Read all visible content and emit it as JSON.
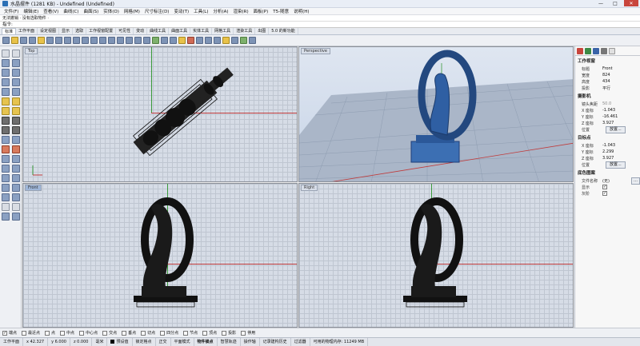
{
  "window": {
    "title": "水晶摆件 (1281 KB) - Undefined (Undefined)",
    "min": "—",
    "max": "□",
    "close": "✕"
  },
  "menu": [
    "文件(F)",
    "编辑(E)",
    "查看(V)",
    "曲线(C)",
    "曲面(S)",
    "实体(O)",
    "网格(M)",
    "尺寸标注(D)",
    "变动(T)",
    "工具(L)",
    "分析(A)",
    "渲染(R)",
    "面板(P)",
    "T5-随意",
    "说明(H)"
  ],
  "command": {
    "history": "无法撤销 · 没有选取物件 ·",
    "prompt": "指令:"
  },
  "tabs": [
    "标准",
    "工作平面",
    "设定视图",
    "显示",
    "选取",
    "工作视窗配置",
    "可见性",
    "变动",
    "曲线工具",
    "曲面工具",
    "实体工具",
    "网格工具",
    "渲染工具",
    "出图",
    "5.0 的新功能"
  ],
  "viewports": {
    "top": "Top",
    "perspective": "Perspective",
    "front": "Front",
    "right": "Right"
  },
  "panel": {
    "section_viewport": "工作视窗",
    "title_label": "标题",
    "title_value": "Front",
    "width_label": "宽度",
    "width_value": "824",
    "height_label": "高度",
    "height_value": "434",
    "projection_label": "投影",
    "projection_value": "平行",
    "section_camera": "摄影机",
    "lens_label": "镜头焦距",
    "lens_value": "50.0",
    "cx_label": "X 座标",
    "cx_value": "-1.043",
    "cy_label": "Y 座标",
    "cy_value": "-16.461",
    "cz_label": "Z 座标",
    "cz_value": "3.927",
    "pos_label": "位置",
    "place_btn": "放置...",
    "section_target": "目标点",
    "tx_label": "X 座标",
    "tx_value": "-1.043",
    "ty_label": "Y 座标",
    "ty_value": "2.299",
    "tz_label": "Z 座标",
    "tz_value": "3.927",
    "tpos_label": "位置",
    "tplace_btn": "放置...",
    "section_wallpaper": "底色图案",
    "file_label": "文件名称",
    "file_value": "(无)",
    "show_label": "显示",
    "gray_label": "灰阶",
    "check": "✓"
  },
  "osnap": [
    "端点",
    "最近点",
    "点",
    "中点",
    "中心点",
    "交点",
    "垂点",
    "切点",
    "四分点",
    "节点",
    "顶点",
    "投影",
    "停用"
  ],
  "status": {
    "workplane": "工作平面",
    "x": "x 42.327",
    "y": "y 6.000",
    "z": "z 0.000",
    "unit": "毫米",
    "layer": "预设值",
    "items": [
      "锁定格点",
      "正交",
      "平面模式",
      "物件锁点",
      "智慧轨迹",
      "操作轴",
      "记录建构历史",
      "过滤器",
      "可用的物理内存: 11249 MB"
    ]
  },
  "colors": {
    "x_axis": "#c03a3a",
    "y_axis": "#3a9a3a",
    "mesh": "#1a1a1a",
    "mesh_blue": "#1f4f8f"
  }
}
